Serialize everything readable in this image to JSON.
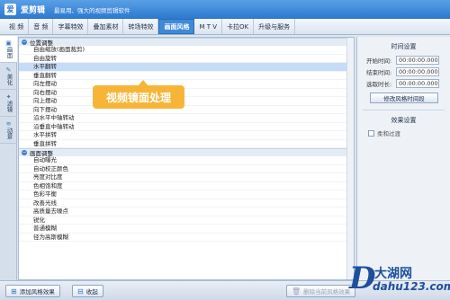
{
  "titlebar": {
    "app_name": "爱剪辑",
    "slogan": "最易用、强大的视频剪辑软件"
  },
  "tabs": [
    {
      "label": "视 频"
    },
    {
      "label": "音 频"
    },
    {
      "label": "字幕特效"
    },
    {
      "label": "叠加素材"
    },
    {
      "label": "转场特效"
    },
    {
      "label": "画面风格",
      "active": true
    },
    {
      "label": "M T V"
    },
    {
      "label": "卡拉OK"
    },
    {
      "label": "升级与服务"
    }
  ],
  "siderail": [
    {
      "label": "画面",
      "icon": "screen-icon"
    },
    {
      "label": "美化",
      "icon": "brush-icon"
    },
    {
      "label": "滤镜",
      "icon": "filter-icon"
    },
    {
      "label": "动景",
      "icon": "motion-icon"
    }
  ],
  "list": {
    "group1": "位置调整",
    "group1_items": [
      "自由缩放(画面裁剪)",
      "自由旋转",
      "水平翻转",
      "垂直翻转",
      "向左摆动",
      "向右摆动",
      "向上摆动",
      "向下摆动",
      "沿水平中轴转动",
      "沿垂直中轴转动",
      "水平拼转",
      "垂直拼转"
    ],
    "selected_item": "水平翻转",
    "group2": "画面调整",
    "group2_items": [
      "自动曝光",
      "自动校正颜色",
      "亮度对比度",
      "色相饱和度",
      "色彩平衡",
      "改善光线",
      "高质量去噪点",
      "锐化",
      "普通模糊",
      "径为高斯模糊"
    ]
  },
  "callout": "视频镜面处理",
  "rightpanel": {
    "time_title": "时间设置",
    "start_label": "开始时间:",
    "start_value": "00:00:00.000",
    "end_label": "结束时间:",
    "end_value": "00:00:00.000",
    "duration_label": "选取时长:",
    "duration_value": "00:00:00.000",
    "modify_button": "修改风格时间段",
    "effect_title": "效果设置",
    "fade_label": "柔和过渡"
  },
  "bottombar": {
    "add_button": "添加风格效果",
    "collapse_button": "收起",
    "delete_button": "删除当前风格效果"
  },
  "watermark": {
    "name": "大湖网",
    "url": "dahu123.com"
  }
}
